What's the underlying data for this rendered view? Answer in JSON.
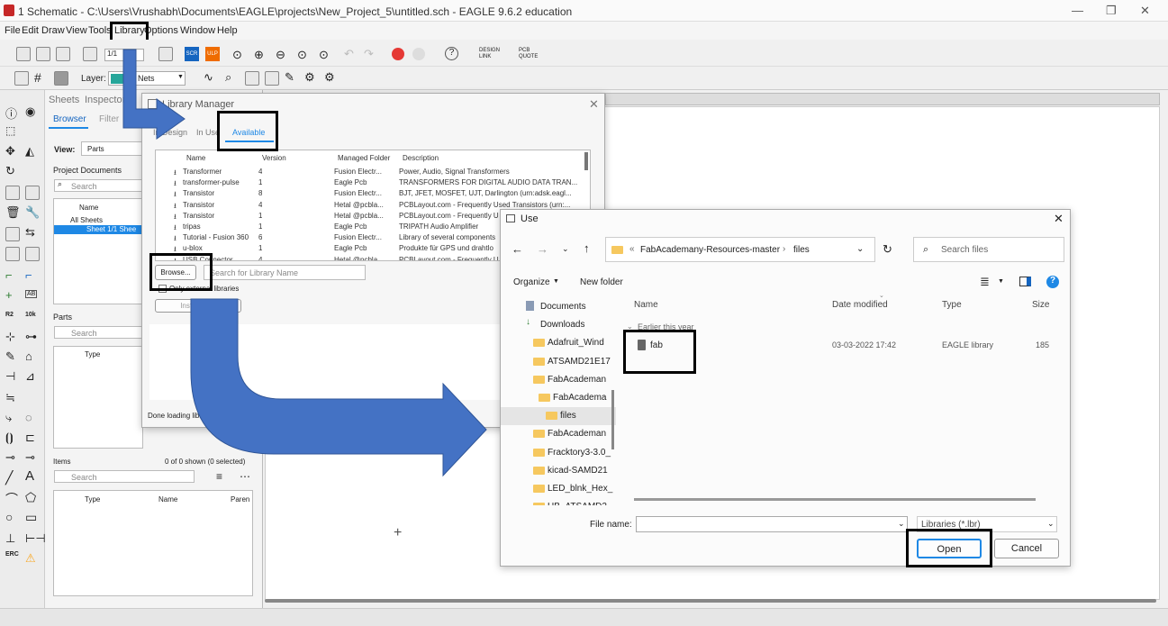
{
  "window": {
    "title": "1 Schematic - C:\\Users\\Vrushabh\\Documents\\EAGLE\\projects\\New_Project_5\\untitled.sch - EAGLE 9.6.2 education"
  },
  "menu": [
    "File",
    "Edit",
    "Draw",
    "View",
    "Tools",
    "Library",
    "Options",
    "Window",
    "Help"
  ],
  "toolbar": {
    "zoom": "1/1",
    "layer_label": "Layer:",
    "layer_value": "Nets",
    "design_link": "DESIGN LINK",
    "pcb_quote": "PCB QUOTE",
    "scr": "SCR",
    "ulp": "ULP"
  },
  "left_panel": {
    "tabs": [
      "Sheets",
      "Inspector"
    ],
    "subtabs": [
      "Browser",
      "Filter"
    ],
    "view_label": "View:",
    "view_value": "Parts",
    "project_documents": "Project Documents",
    "search": "Search",
    "name_col": "Name",
    "all_sheets": "All Sheets",
    "sheet": "Sheet 1/1  Shee",
    "parts": "Parts",
    "type_col": "Type",
    "items": "Items",
    "items_count": "0 of 0 shown (0 selected)",
    "items_cols": [
      "Type",
      "Name",
      "Paren"
    ]
  },
  "library_manager": {
    "title": "Library Manager",
    "tabs": [
      "In Design",
      "In Use",
      "Available"
    ],
    "columns": [
      "Name",
      "Version",
      "Managed Folder",
      "Description"
    ],
    "rows": [
      [
        "Transformer",
        "4",
        "Fusion Electr...",
        "Power, Audio, Signal Transformers"
      ],
      [
        "transformer-pulse",
        "1",
        "Eagle Pcb",
        "TRANSFORMERS FOR DIGITAL AUDIO DATA TRAN..."
      ],
      [
        "Transistor",
        "8",
        "Fusion Electr...",
        "BJT, JFET, MOSFET, UJT, Darlington (urn:adsk.eagl..."
      ],
      [
        "Transistor",
        "4",
        "Hetal @pcbla...",
        "PCBLayout.com - Frequently Used Transistors (urn:..."
      ],
      [
        "Transistor",
        "1",
        "Hetal @pcbla...",
        "PCBLayout.com - Frequently U"
      ],
      [
        "tripas",
        "1",
        "Eagle Pcb",
        "TRIPATH Audio Amplifier"
      ],
      [
        "Tutorial - Fusion 360",
        "6",
        "Fusion Electr...",
        "Library of several components"
      ],
      [
        "u-blox",
        "1",
        "Eagle Pcb",
        "Produkte für GPS und drahtlo"
      ],
      [
        "USB Connector",
        "4",
        "Hetal @pcbla...",
        "PCBLayout.com - Frequently U"
      ]
    ],
    "browse": "Browse...",
    "search_placeholder": "Search for Library Name",
    "only_external": "Only external libraries",
    "install": "Install Bu...",
    "status": "Done loading libr..."
  },
  "use_dialog": {
    "title": "Use",
    "breadcrumb": [
      "FabAcademany-Resources-master",
      "files"
    ],
    "search_placeholder": "Search files",
    "organize": "Organize",
    "new_folder": "New folder",
    "nav": [
      {
        "label": "Documents",
        "type": "doc"
      },
      {
        "label": "Downloads",
        "type": "dl"
      },
      {
        "label": "Adafruit_Wind",
        "type": "folder"
      },
      {
        "label": "ATSAMD21E17",
        "type": "folder"
      },
      {
        "label": "FabAcademan",
        "type": "folder"
      },
      {
        "label": "FabAcadema",
        "type": "folder"
      },
      {
        "label": "files",
        "type": "folder"
      },
      {
        "label": "FabAcademan",
        "type": "folder"
      },
      {
        "label": "Fracktory3-3.0_",
        "type": "folder"
      },
      {
        "label": "kicad-SAMD21",
        "type": "folder"
      },
      {
        "label": "LED_blnk_Hex_",
        "type": "folder"
      },
      {
        "label": "UB_ATSAMD2",
        "type": "folder"
      }
    ],
    "columns": [
      "Name",
      "Date modified",
      "Type",
      "Size"
    ],
    "group": "Earlier this year",
    "file": {
      "name": "fab",
      "date": "03-03-2022 17:42",
      "type": "EAGLE library",
      "size": "185"
    },
    "file_name_label": "File name:",
    "file_name_value": "",
    "filter": "Libraries (*.lbr)",
    "open": "Open",
    "cancel": "Cancel"
  },
  "colors": {
    "accent": "#1e88e5",
    "arrow": "#4472c4",
    "selected": "#cce8ff"
  }
}
